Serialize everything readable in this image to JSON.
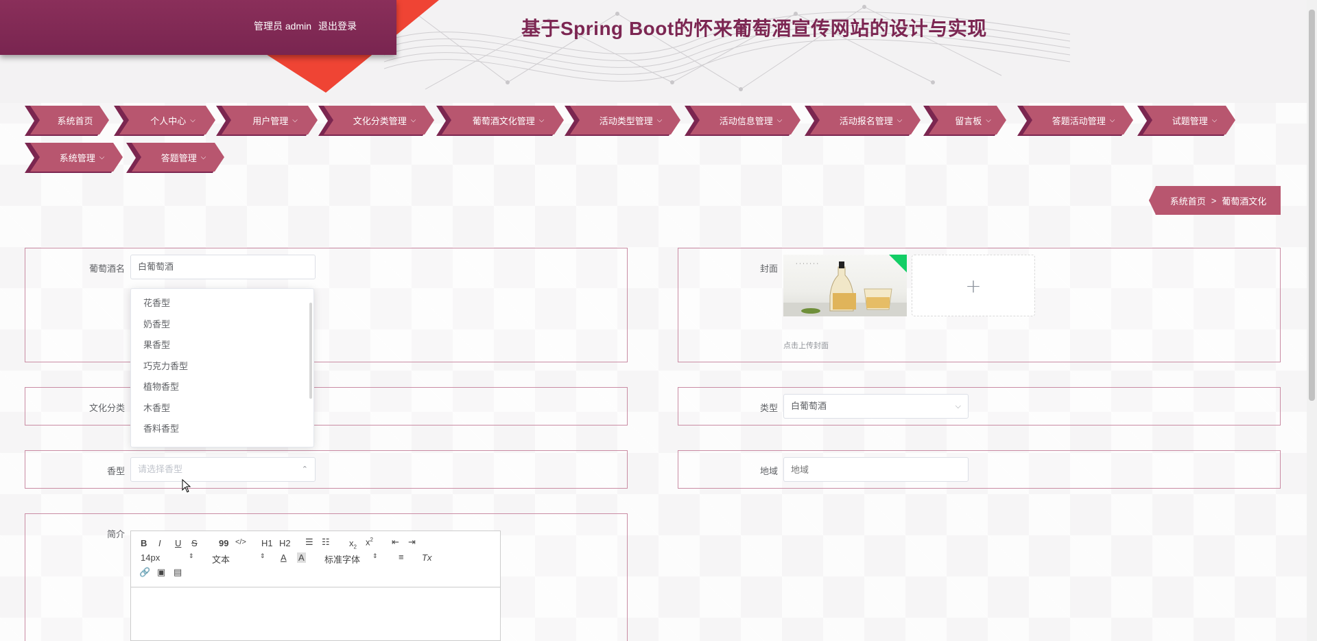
{
  "header": {
    "user_label": "管理员 admin",
    "logout_label": "退出登录",
    "site_title": "基于Spring Boot的怀来葡萄酒宣传网站的设计与实现"
  },
  "nav": {
    "items": [
      {
        "label": "系统首页",
        "has_menu": false
      },
      {
        "label": "个人中心",
        "has_menu": true
      },
      {
        "label": "用户管理",
        "has_menu": true
      },
      {
        "label": "文化分类管理",
        "has_menu": true
      },
      {
        "label": "葡萄酒文化管理",
        "has_menu": true
      },
      {
        "label": "活动类型管理",
        "has_menu": true
      },
      {
        "label": "活动信息管理",
        "has_menu": true
      },
      {
        "label": "活动报名管理",
        "has_menu": true
      },
      {
        "label": "留言板",
        "has_menu": true
      },
      {
        "label": "答题活动管理",
        "has_menu": true
      },
      {
        "label": "试题管理",
        "has_menu": true
      },
      {
        "label": "系统管理",
        "has_menu": true
      },
      {
        "label": "答题管理",
        "has_menu": true
      }
    ]
  },
  "breadcrumb": {
    "home": "系统首页",
    "separator": ">",
    "current": "葡萄酒文化"
  },
  "form": {
    "wine_name": {
      "label": "葡萄酒名",
      "value": "白葡萄酒"
    },
    "cover": {
      "label": "封面",
      "tip": "点击上传封面",
      "add_symbol": "+"
    },
    "culture_category": {
      "label": "文化分类"
    },
    "type": {
      "label": "类型",
      "value": "白葡萄酒"
    },
    "aroma": {
      "label": "香型",
      "placeholder": "请选择香型"
    },
    "region": {
      "label": "地域",
      "placeholder": "地域"
    },
    "intro": {
      "label": "简介"
    }
  },
  "aroma_dropdown": {
    "options": [
      "花香型",
      "奶香型",
      "果香型",
      "巧克力香型",
      "植物香型",
      "木香型",
      "香料香型"
    ]
  },
  "editor_toolbar": {
    "bold": "B",
    "italic": "I",
    "underline": "U",
    "strike": "S",
    "quote": "99",
    "code": "</>",
    "h1": "H1",
    "h2": "H2",
    "size": "14px",
    "header": "文本",
    "font": "标准字体",
    "color": "A",
    "background": "A",
    "clean": "Tx"
  },
  "colors": {
    "brand": "#7c2652",
    "nav_bg": "#b8566f",
    "accent_red": "#ef4434",
    "upload_badge": "#13ce66"
  }
}
